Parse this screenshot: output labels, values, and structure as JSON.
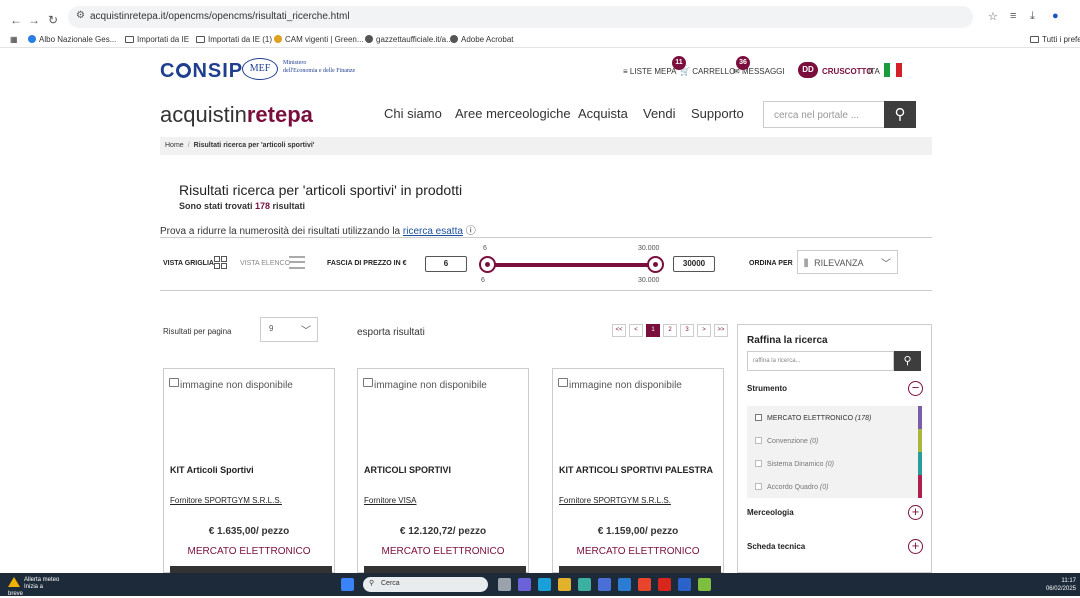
{
  "browser": {
    "url": "acquistinretepa.it/opencms/opencms/risultati_ricerche.html",
    "bookmarks": [
      "Albo Nazionale Ges...",
      "Importati da IE",
      "Importati da IE (1)",
      "CAM vigenti | Green...",
      "gazzettaufficiale.it/a...",
      "Adobe Acrobat"
    ],
    "bookmarks_right": "Tutti i prefer"
  },
  "topbar": {
    "consip": "CONSIP",
    "mef": "MEF",
    "ministero_line1": "Ministero",
    "ministero_line2": "dell'Economia e delle Finanze",
    "liste_mepa": "LISTE MEPA",
    "carrello": "CARRELLO",
    "carrello_badge": "11",
    "messaggi": "MESSAGGI",
    "messaggi_badge": "36",
    "user_initials": "DD",
    "cruscotto": "CRUSCOTTO",
    "lang": "ITA"
  },
  "header": {
    "logo_pre": "acquistin",
    "logo_mid": "rete",
    "logo_post": "pa",
    "nav": [
      "Chi siamo",
      "Aree merceologiche",
      "Acquista",
      "Vendi",
      "Supporto"
    ],
    "search_placeholder": "cerca nel portale ..."
  },
  "breadcrumb": {
    "home": "Home",
    "sep": "/",
    "current": "Risultati ricerca per 'articoli sportivi'"
  },
  "results": {
    "title": "Risultati ricerca per 'articoli sportivi' in prodotti",
    "found_pre": "Sono stati trovati ",
    "found_count": "178",
    "found_post": " risultati",
    "hint_pre": "Prova a ridurre la numerosità dei risultati utilizzando la ",
    "hint_link": "ricerca esatta",
    "hint_icon": "ⓘ"
  },
  "toolbar": {
    "vista_griglia": "VISTA GRIGLIA",
    "vista_elenco": "VISTA ELENCO",
    "fascia_prezzo": "FASCIA DI PREZZO IN €",
    "price_min": "6",
    "price_max": "30000",
    "tick_min_top": "6",
    "tick_max_top": "30.000",
    "tick_min_bottom": "6",
    "tick_max_bottom": "30.000",
    "ordina_per": "ORDINA PER",
    "ordina_value": "RILEVANZA"
  },
  "listing": {
    "per_page_label": "Risultati per pagina",
    "per_page_value": "9",
    "export": "esporta risultati",
    "pages": [
      "<<",
      "<",
      "1",
      "2",
      "3",
      ">",
      ">>"
    ],
    "active_page": "1"
  },
  "cards": [
    {
      "img": "immagine non disponibile",
      "title": "KIT Articoli Sportivi",
      "supplier": "Fornitore SPORTGYM S.R.L.S.",
      "price": "€ 1.635,00/ pezzo",
      "market": "MERCATO ELETTRONICO"
    },
    {
      "img": "immagine non disponibile",
      "title": "ARTICOLI SPORTIVI",
      "supplier": "Fornitore VISA",
      "price": "€ 12.120,72/ pezzo",
      "market": "MERCATO ELETTRONICO"
    },
    {
      "img": "immagine non disponibile",
      "title": "KIT ARTICOLI SPORTIVI PALESTRA",
      "supplier": "Fornitore SPORTGYM S.R.L.S.",
      "price": "€ 1.159,00/ pezzo",
      "market": "MERCATO ELETTRONICO"
    }
  ],
  "refine": {
    "title": "Raffina la ricerca",
    "placeholder": "raffina la ricerca...",
    "strumento": "Strumento",
    "options": [
      {
        "label": "MERCATO ELETTRONICO ",
        "count": "(178)",
        "color": "#7b5ea7"
      },
      {
        "label": "Convenzione ",
        "count": "(0)",
        "color": "#a9b83c"
      },
      {
        "label": "Sistema Dinamico ",
        "count": "(0)",
        "color": "#2a9d9a"
      },
      {
        "label": "Accordo Quadro ",
        "count": "(0)",
        "color": "#b0204f"
      }
    ],
    "merceologia": "Merceologia",
    "scheda_tecnica": "Scheda tecnica"
  },
  "taskbar": {
    "weather_title": "Allerta meteo",
    "weather_sub": "Inizia a breve",
    "search": "Cerca",
    "time": "11:17",
    "date": "06/02/2025"
  },
  "colors": {
    "brand": "#7a0f3e",
    "consip_blue": "#1f3f8e"
  }
}
